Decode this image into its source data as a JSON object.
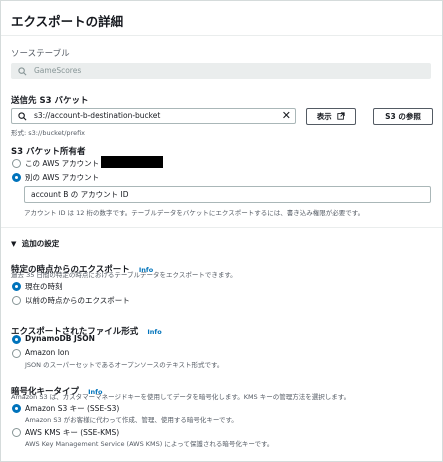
{
  "panel": {
    "title": "エクスポートの詳細"
  },
  "source_table": {
    "label": "ソーステーブル",
    "value": "GameScores"
  },
  "destination": {
    "label": "送信先 S3 バケット",
    "value": "s3://account-b-destination-bucket",
    "hint": "形式: s3://bucket/prefix",
    "view_label": "表示",
    "browse_label": "S3 の参照"
  },
  "bucket_owner": {
    "label": "S3 バケット所有者",
    "option_this": "この AWS アカウント",
    "option_other": "別の AWS アカウント",
    "account_value": "account B の アカウント ID",
    "account_hint": "アカウント ID は 12 桁の数字です。テーブルデータをバケットにエクスポートするには、書き込み権限が必要です。"
  },
  "additional": {
    "label": "追加の設定"
  },
  "pitr": {
    "label": "特定の時点からのエクスポート",
    "info": "Info",
    "desc": "過去 35 日間の特定の時点におけるテーブルデータをエクスポートできます。",
    "option_now": "現在の時刻",
    "option_earlier": "以前の時点からのエクスポート"
  },
  "format": {
    "label": "エクスポートされたファイル形式",
    "info": "Info",
    "option_json": "DynamoDB JSON",
    "option_ion": "Amazon Ion",
    "ion_desc": "JSON のスーパーセットであるオープンソースのテキスト形式です。"
  },
  "encryption": {
    "label": "暗号化キータイプ",
    "info": "Info",
    "desc": "Amazon S3 は、カスタマーマネージドキーを使用してデータを暗号化します。KMS キーの管理方法を選択します。",
    "option_s3": "Amazon S3 キー (SSE-S3)",
    "s3_desc": "Amazon S3 がお客様に代わって作成、管理、使用する暗号化キーです。",
    "option_kms": "AWS KMS キー (SSE-KMS)",
    "kms_desc": "AWS Key Management Service (AWS KMS) によって保護される暗号化キーです。"
  },
  "colors": {
    "accent": "#0073bb",
    "text": "#16191f",
    "muted": "#545b64"
  }
}
